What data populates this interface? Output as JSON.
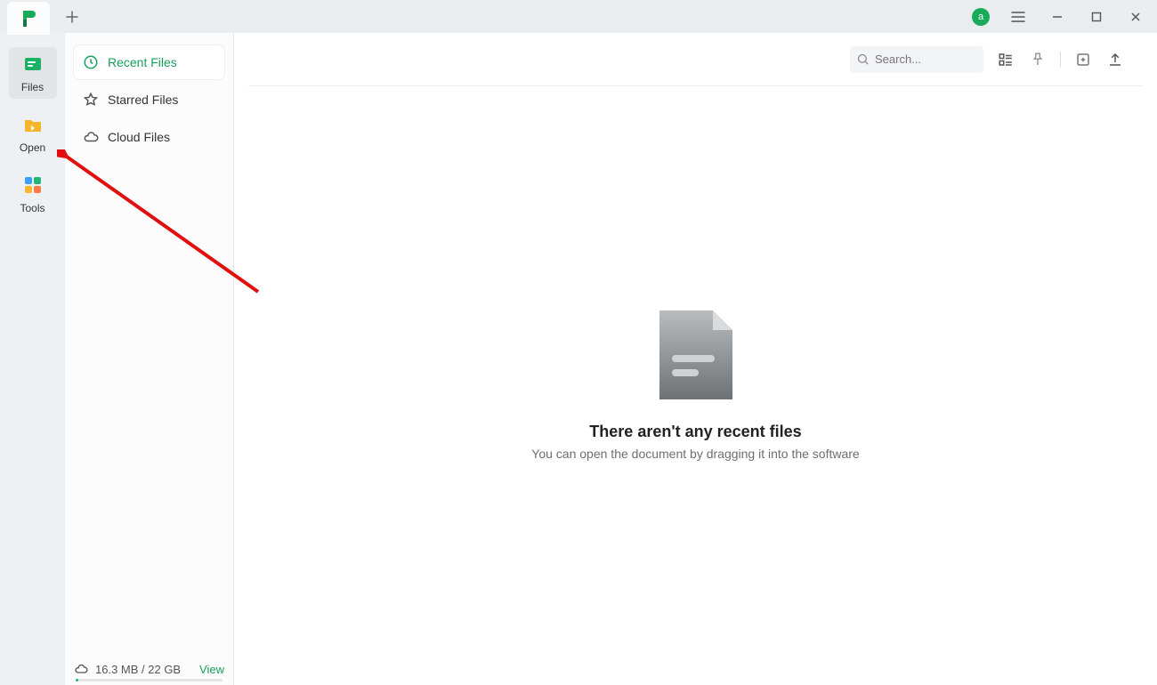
{
  "titlebar": {
    "avatar_initial": "a"
  },
  "leftrail": {
    "items": [
      {
        "label": "Files"
      },
      {
        "label": "Open"
      },
      {
        "label": "Tools"
      }
    ]
  },
  "filespanel": {
    "items": [
      {
        "label": "Recent Files"
      },
      {
        "label": "Starred Files"
      },
      {
        "label": "Cloud Files"
      }
    ],
    "storage_text": "16.3 MB / 22 GB",
    "view_label": "View"
  },
  "topbar": {
    "search_placeholder": "Search..."
  },
  "empty": {
    "title": "There aren't any recent files",
    "subtitle": "You can open the document by dragging it into the software"
  }
}
